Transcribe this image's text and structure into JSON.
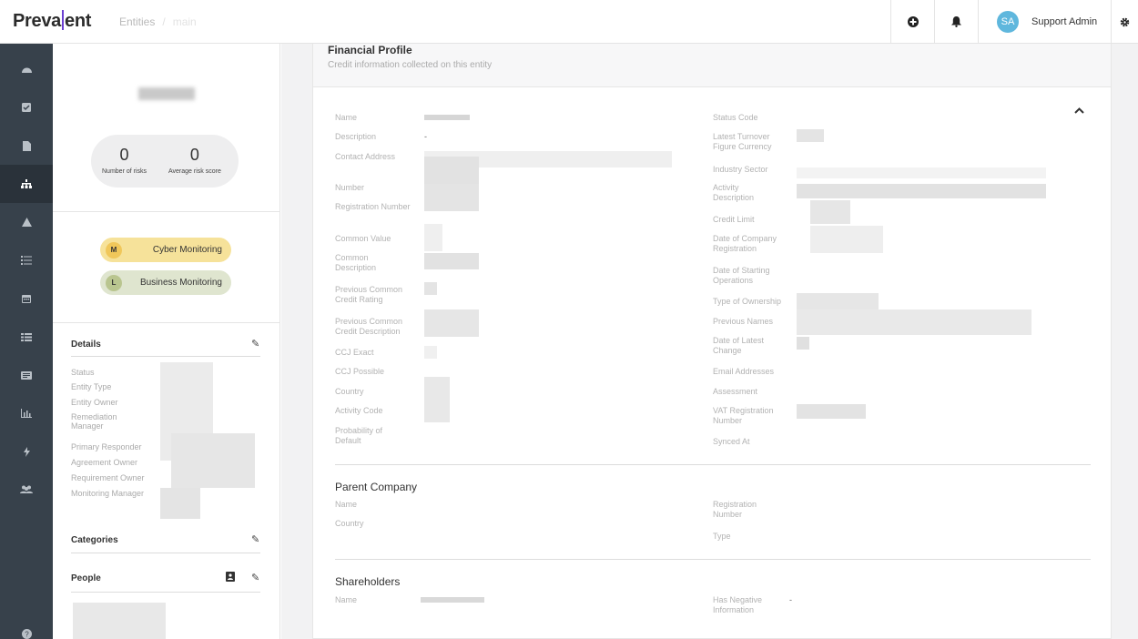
{
  "app": {
    "logo": "Prevalent",
    "breadcrumb": [
      "Entities",
      "main"
    ]
  },
  "topbar": {
    "add_icon": "plus-circle-icon",
    "bell_icon": "bell-icon",
    "user_initials": "SA",
    "user_name": "Support Admin",
    "settings_icon": "gear-icon"
  },
  "sidenav": [
    {
      "icon": "dashboard-icon"
    },
    {
      "icon": "check-square-icon"
    },
    {
      "icon": "document-icon"
    },
    {
      "icon": "hierarchy-icon",
      "active": true
    },
    {
      "icon": "warning-icon"
    },
    {
      "icon": "task-list-icon"
    },
    {
      "icon": "calendar-icon"
    },
    {
      "icon": "list-icon"
    },
    {
      "icon": "report-icon"
    },
    {
      "icon": "analytics-icon"
    },
    {
      "icon": "lightning-icon"
    },
    {
      "icon": "people-icon"
    },
    {
      "icon": "help-icon"
    }
  ],
  "profile": {
    "risks_count": "0",
    "risks_label": "Number of risks",
    "avg_score": "0",
    "avg_label": "Average risk score",
    "monitoring": [
      {
        "badge": "M",
        "label": "Cyber Monitoring",
        "color": "#f6e29a",
        "badge_color": "#f0c75a"
      },
      {
        "badge": "L",
        "label": "Business Monitoring",
        "color": "#dfe5cf",
        "badge_color": "#b9c58f"
      }
    ],
    "details_title": "Details",
    "details_fields": [
      "Status",
      "Entity Type",
      "Entity Owner",
      "Remediation Manager",
      "Primary Responder",
      "Agreement Owner",
      "Requirement Owner",
      "Monitoring Manager"
    ],
    "categories_title": "Categories",
    "people_title": "People"
  },
  "financial": {
    "title": "Financial Profile",
    "subtitle": "Credit information collected on this entity",
    "left_fields": {
      "name": "Name",
      "description": "Description",
      "description_value": "-",
      "contact_address": "Contact Address",
      "number": "Number",
      "registration_number": "Registration Number",
      "common_value": "Common Value",
      "common_description": "Common Description",
      "prev_common_credit_rating": "Previous Common Credit Rating",
      "prev_common_credit_description": "Previous Common Credit Description",
      "ccj_exact": "CCJ Exact",
      "ccj_possible": "CCJ Possible",
      "country": "Country",
      "activity_code": "Activity Code",
      "probability_of_default": "Probability of Default"
    },
    "right_fields": {
      "status_code": "Status Code",
      "latest_turnover": "Latest Turnover Figure Currency",
      "industry_sector": "Industry Sector",
      "activity_description": "Activity Description",
      "credit_limit": "Credit Limit",
      "date_company_registration": "Date of Company Registration",
      "date_starting_operations": "Date of Starting Operations",
      "type_of_ownership": "Type of Ownership",
      "previous_names": "Previous Names",
      "date_latest_change": "Date of Latest Change",
      "email_addresses": "Email Addresses",
      "assessment": "Assessment",
      "vat_registration": "VAT Registration Number",
      "synced_at": "Synced At"
    },
    "parent_company": {
      "title": "Parent Company",
      "name": "Name",
      "country": "Country",
      "registration_number": "Registration Number",
      "type": "Type"
    },
    "shareholders": {
      "title": "Shareholders",
      "name": "Name",
      "has_negative": "Has Negative Information",
      "has_negative_value": "-"
    }
  }
}
